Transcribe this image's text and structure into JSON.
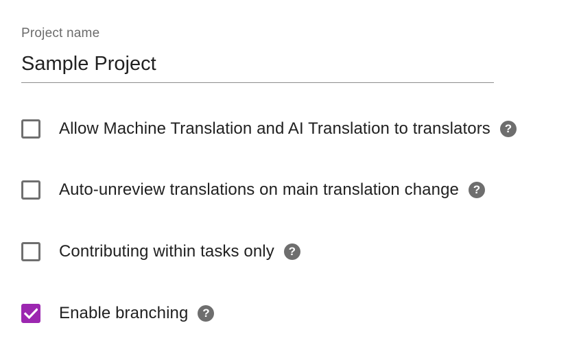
{
  "project": {
    "label": "Project name",
    "value": "Sample Project"
  },
  "options": [
    {
      "label": "Allow Machine Translation and AI Translation to translators",
      "checked": false
    },
    {
      "label": "Auto-unreview translations on main translation change",
      "checked": false
    },
    {
      "label": "Contributing within tasks only",
      "checked": false
    },
    {
      "label": "Enable branching",
      "checked": true
    }
  ],
  "icons": {
    "help": "help-circle-icon",
    "check": "check-icon",
    "help_glyph": "?"
  },
  "colors": {
    "accent": "#9c27b0",
    "checkbox_border": "#6f6f6f",
    "help_icon": "#6e6e6e",
    "label_muted": "#6b6b6b",
    "underline": "#8c8c8c"
  }
}
